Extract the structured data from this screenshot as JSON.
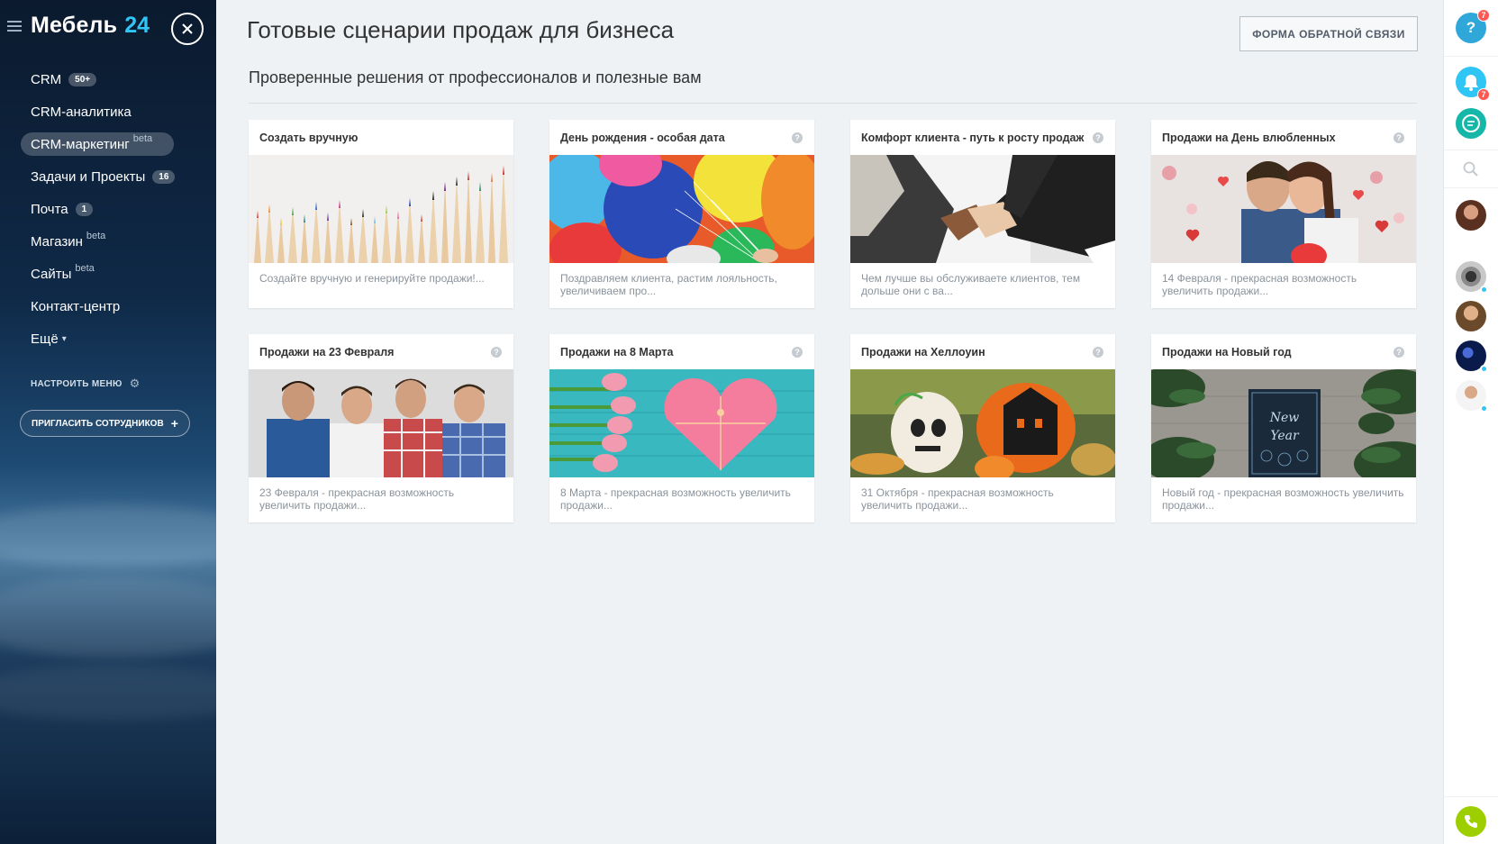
{
  "sidebar": {
    "brand_name": "Мебель",
    "brand_number": "24",
    "items": [
      {
        "label": "CRM",
        "counter": "50+",
        "sup": ""
      },
      {
        "label": "CRM-аналитика",
        "counter": "",
        "sup": ""
      },
      {
        "label": "CRM-маркетинг",
        "counter": "",
        "sup": "beta"
      },
      {
        "label": "Задачи и Проекты",
        "counter": "16",
        "sup": ""
      },
      {
        "label": "Почта",
        "counter": "1",
        "sup": ""
      },
      {
        "label": "Магазин",
        "counter": "",
        "sup": "beta"
      },
      {
        "label": "Сайты",
        "counter": "",
        "sup": "beta"
      },
      {
        "label": "Контакт-центр",
        "counter": "",
        "sup": ""
      },
      {
        "label": "Ещё",
        "counter": "",
        "sup": ""
      }
    ],
    "settings_label": "НАСТРОИТЬ МЕНЮ",
    "invite_label": "ПРИГЛАСИТЬ СОТРУДНИКОВ"
  },
  "main": {
    "title": "Готовые сценарии продаж для бизнеса",
    "feedback_label": "ФОРМА ОБРАТНОЙ СВЯЗИ",
    "subtitle": "Проверенные решения от профессионалов и полезные вам",
    "cards": [
      {
        "title": "Создать вручную",
        "desc": "Создайте вручную и генерируйте продажи!...",
        "has_help": false,
        "image": "pencils"
      },
      {
        "title": "День рождения - особая дата",
        "desc": "Поздравляем клиента, растим лояльность, увеличиваем про...",
        "has_help": true,
        "image": "balloons"
      },
      {
        "title": "Комфорт клиента - путь к росту продаж",
        "desc": "Чем лучше вы обслуживаете клиентов, тем дольше они с ва...",
        "has_help": true,
        "image": "handshake"
      },
      {
        "title": "Продажи на День влюбленных",
        "desc": "14 Февраля - прекрасная возможность увеличить продажи...",
        "has_help": true,
        "image": "couple"
      },
      {
        "title": "Продажи на 23 Февраля",
        "desc": "23 Февраля - прекрасная возможность увеличить продажи...",
        "has_help": true,
        "image": "men"
      },
      {
        "title": "Продажи на 8 Марта",
        "desc": "8 Марта - прекрасная возможность увеличить продажи...",
        "has_help": true,
        "image": "heart-box"
      },
      {
        "title": "Продажи на Хеллоуин",
        "desc": "31 Октября - прекрасная возможность увеличить продажи...",
        "has_help": true,
        "image": "pumpkins"
      },
      {
        "title": "Продажи на Новый год",
        "desc": "Новый год - прекрасная возможность увеличить продажи...",
        "has_help": true,
        "image": "new-year"
      }
    ]
  },
  "rightbar": {
    "help_badge": "7",
    "notify_badge": "7"
  },
  "colors": {
    "accent": "#2fc6f6",
    "badge": "#ff5752",
    "phone": "#9dcf00"
  }
}
